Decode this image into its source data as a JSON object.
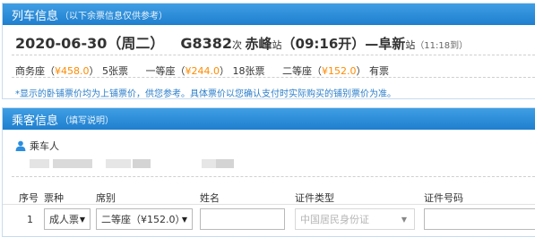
{
  "train_info": {
    "title": "列车信息",
    "subtitle": "（以下余票信息仅供参考）",
    "date": "2020-06-30",
    "weekday": "（周二）",
    "train_no": "G8382",
    "train_suffix": "次",
    "from_station": "赤峰",
    "station_suffix": "站",
    "depart": "（09:16开）",
    "dash": "—",
    "to_station": "阜新",
    "arrive": "（11:18到）",
    "seats": [
      {
        "name": "商务座",
        "open": "（",
        "price": "¥458.0",
        "close": "）",
        "status": "5张票"
      },
      {
        "name": "一等座",
        "open": "（",
        "price": "¥244.0",
        "close": "）",
        "status": "18张票"
      },
      {
        "name": "二等座",
        "open": "（",
        "price": "¥152.0",
        "close": "）",
        "status": "有票"
      }
    ],
    "note": "*显示的卧铺票价均为上铺票价，供您参考。具体票价以您确认支付时实际购买的铺别票价为准。"
  },
  "passenger_info": {
    "title": "乘客信息",
    "subtitle": "（填写说明）",
    "passenger_label": "乘车人",
    "user_icon": "user-icon",
    "headers": [
      "序号",
      "票种",
      "席别",
      "姓名",
      "证件类型",
      "证件号码"
    ],
    "row": {
      "index": "1",
      "ticket_type": "成人票",
      "seat_class": "二等座（¥152.0）",
      "name_value": "",
      "id_type": "中国居民身份证",
      "id_number": ""
    }
  },
  "colors": {
    "header_blue": "#1f7fcf",
    "price_orange": "#ff8a00",
    "note_blue": "#2a7dc9",
    "disabled_gray": "#b5b5b5"
  }
}
